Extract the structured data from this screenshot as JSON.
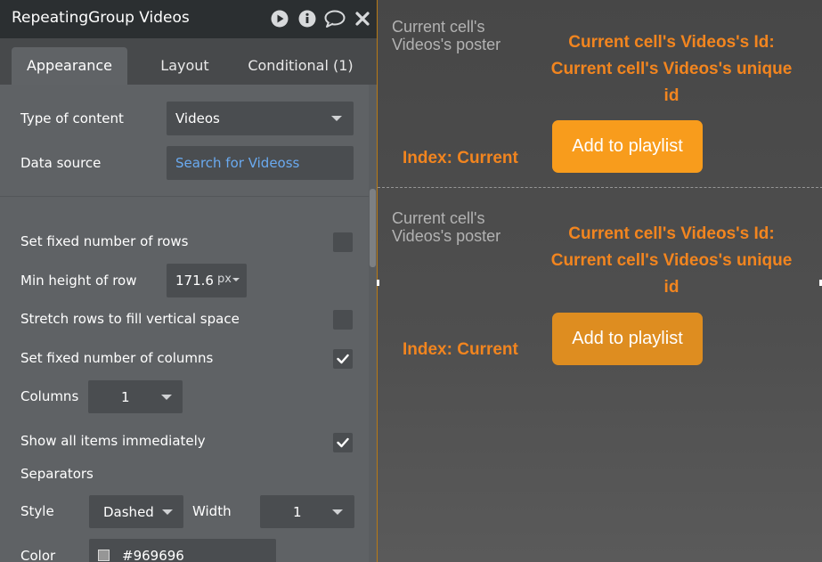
{
  "editor": {
    "title": "RepeatingGroup Videos",
    "title_icons": [
      "play-icon",
      "info-icon",
      "comment-icon",
      "close-icon"
    ],
    "tabs": [
      {
        "label": "Appearance",
        "active": true
      },
      {
        "label": "Layout",
        "active": false
      },
      {
        "label": "Conditional (1)",
        "active": false
      }
    ],
    "fields": {
      "type_of_content": {
        "label": "Type of content",
        "value": "Videos"
      },
      "data_source": {
        "label": "Data source",
        "value": "Search for Videoss"
      },
      "fixed_rows": {
        "label": "Set fixed number of rows",
        "checked": false
      },
      "min_height": {
        "label": "Min height of row",
        "value": "171.6(",
        "unit": "px"
      },
      "stretch_rows": {
        "label": "Stretch rows to fill vertical space",
        "checked": false
      },
      "fixed_columns": {
        "label": "Set fixed number of columns",
        "checked": true
      },
      "columns": {
        "label": "Columns",
        "value": "1"
      },
      "show_all": {
        "label": "Show all items immediately",
        "checked": true
      },
      "separators_heading": "Separators",
      "style": {
        "label": "Style",
        "value": "Dashed"
      },
      "width": {
        "label": "Width",
        "value": "1"
      },
      "color": {
        "label": "Color",
        "value": "#969696"
      }
    }
  },
  "canvas": {
    "cells": [
      {
        "poster_text": "Current cell's Videos's poster",
        "id_text": "Current cell's Videos's Id: Current cell's Videos's unique id",
        "index_text": "Index: Current",
        "button_label": "Add to playlist",
        "button_color": "#f89c1c"
      },
      {
        "poster_text": "Current cell's Videos's poster",
        "id_text": "Current cell's Videos's Id: Current cell's Videos's unique id",
        "index_text": "Index: Current",
        "button_label": "Add to playlist",
        "button_color": "#de8d20"
      }
    ],
    "separator_color": "#969696",
    "accent_color": "#f2851f"
  }
}
